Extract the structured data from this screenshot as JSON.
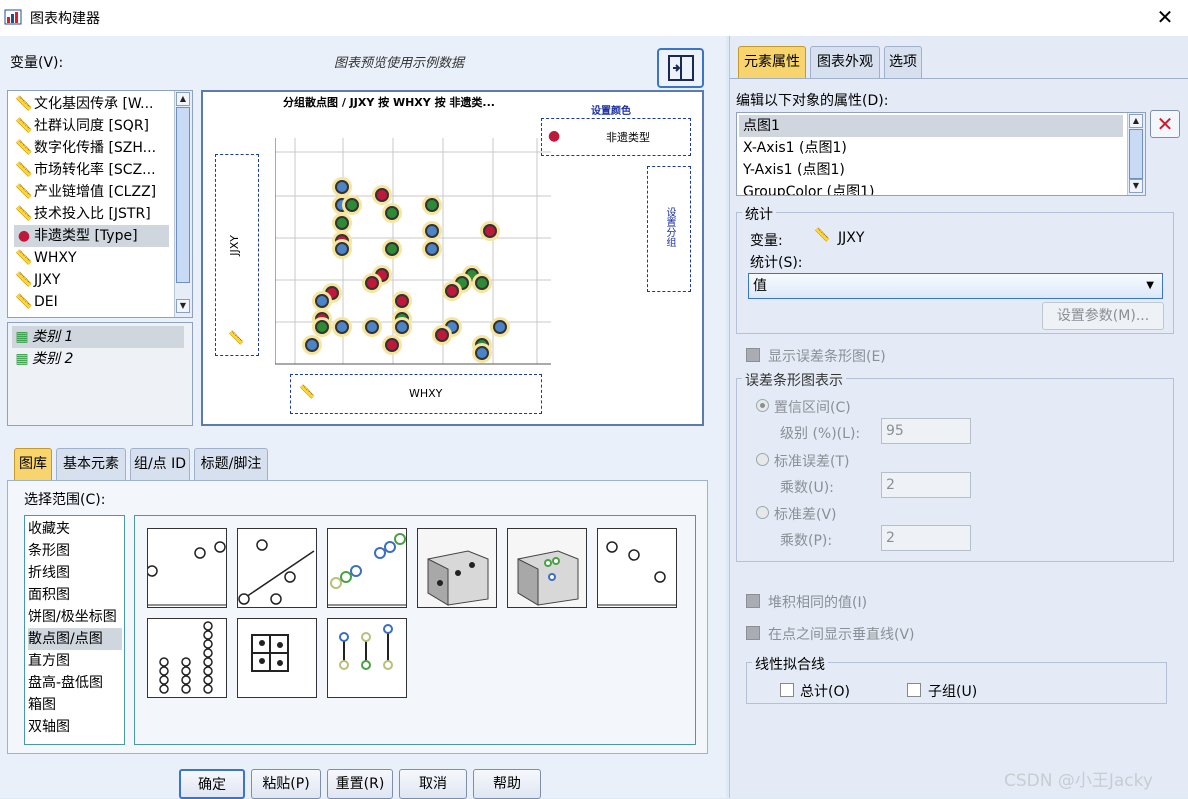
{
  "window": {
    "title": "图表构建器",
    "close_glyph": "✕"
  },
  "variables": {
    "label": "变量(V):",
    "items": [
      "文化基因传承 [W...",
      "社群认同度 [SQR]",
      "数字化传播 [SZH...",
      "市场转化率 [SCZ...",
      "产业链增值 [CLZZ]",
      "技术投入比 [JSTR]",
      "非遗类型 [Type]",
      "WHXY",
      "JJXY",
      "DEI"
    ],
    "selected_index": 6,
    "categories": [
      "类别 1",
      "类别 2"
    ]
  },
  "preview": {
    "caption": "图表预览使用示例数据",
    "chart_title": "分组散点图 / JJXY 按 WHXY 按 非遗类...",
    "set_color": "设置颜色",
    "legend_var": "非遗类型",
    "y_axis_var": "JJXY",
    "x_axis_var": "WHXY",
    "right_dropzone": "设置分组"
  },
  "gallery_tabs": [
    "图库",
    "基本元素",
    "组/点 ID",
    "标题/脚注"
  ],
  "gallery": {
    "range_label": "选择范围(C):",
    "categories": [
      "收藏夹",
      "条形图",
      "折线图",
      "面积图",
      "饼图/极坐标图",
      "散点图/点图",
      "直方图",
      "盘高-盘低图",
      "箱图",
      "双轴图"
    ],
    "selected_index": 5
  },
  "buttons": {
    "ok": "确定",
    "paste": "粘贴(P)",
    "reset": "重置(R)",
    "cancel": "取消",
    "help": "帮助"
  },
  "right_tabs": [
    "元素属性",
    "图表外观",
    "选项"
  ],
  "properties": {
    "edit_label": "编辑以下对象的属性(D):",
    "objects": [
      "点图1",
      "X-Axis1 (点图1)",
      "Y-Axis1 (点图1)",
      "GroupColor (点图1)"
    ],
    "selected_index": 0
  },
  "stats": {
    "group_title": "统计",
    "variable_label": "变量:",
    "variable_value": "JJXY",
    "statistic_label": "统计(S):",
    "statistic_value": "值",
    "set_params": "设置参数(M)..."
  },
  "errorbars": {
    "show_label": "显示误差条形图(E)",
    "group_title": "误差条形图表示",
    "ci_label": "置信区间(C)",
    "level_label": "级别 (%)(L):",
    "level_value": "95",
    "se_label": "标准误差(T)",
    "se_mult_label": "乘数(U):",
    "se_mult_value": "2",
    "sd_label": "标准差(V)",
    "sd_mult_label": "乘数(P):",
    "sd_mult_value": "2"
  },
  "options": {
    "stack_label": "堆积相同的值(I)",
    "drop_lines_label": "在点之间显示垂直线(V)"
  },
  "fitline": {
    "group_title": "线性拟合线",
    "total_label": "总计(O)",
    "subgroup_label": "子组(U)"
  },
  "watermark": "CSDN @小王Jacky"
}
